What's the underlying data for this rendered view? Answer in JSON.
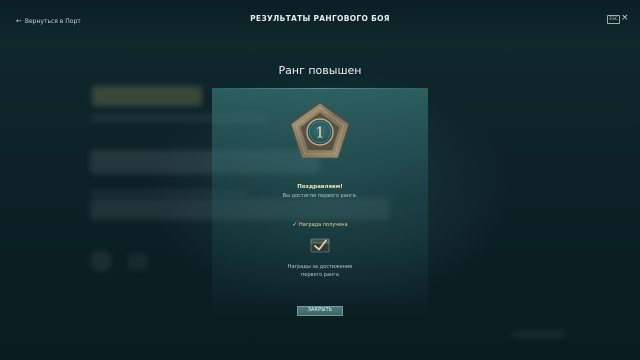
{
  "header": {
    "back_label": "Вернуться в Порт",
    "title": "РЕЗУЛЬТАТЫ РАНГОВОГО БОЯ",
    "esc_label": "ESC"
  },
  "rank": {
    "title": "Ранг повышен",
    "number": "1"
  },
  "congrats": {
    "title": "Поздравляем!",
    "text": "Вы достигли первого ранга."
  },
  "reward": {
    "status": "Награда получена",
    "description_line1": "Награды за достижение",
    "description_line2": "первого ранга"
  },
  "actions": {
    "close_label": "ЗАКРЫТЬ"
  },
  "colors": {
    "accent_gold": "#e8d89a",
    "badge_fill": "#2c5c5f",
    "button_bg": "#3a6468"
  }
}
